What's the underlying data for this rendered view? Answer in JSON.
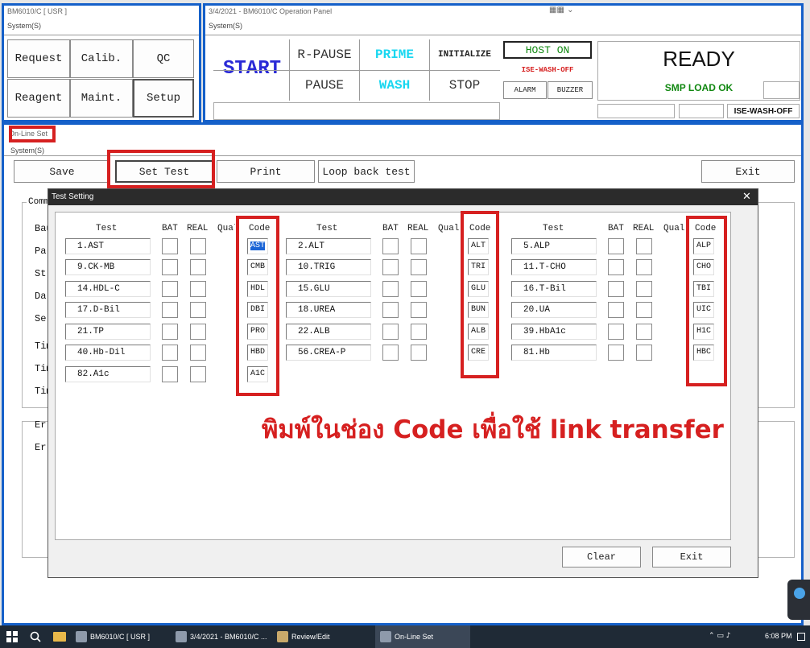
{
  "main_window": {
    "title": "BM6010/C [ USR ]",
    "menu": "System(S)",
    "buttons": [
      "Request",
      "Calib.",
      "QC",
      "Reagent",
      "Maint.",
      "Setup"
    ]
  },
  "operation_panel": {
    "title": "3/4/2021 - BM6010/C Operation Panel",
    "menu": "System(S)",
    "start": "START",
    "r_pause": "R-PAUSE",
    "pause": "PAUSE",
    "prime": "PRIME",
    "wash": "WASH",
    "initialize": "INITIALIZE",
    "stop": "STOP",
    "host_on": "HOST ON",
    "ise_wash_off": "ISE-WASH-OFF",
    "alarm": "ALARM",
    "buzzer": "BUZZER",
    "ready": "READY",
    "smp_load_ok": "SMP LOAD OK",
    "ise_wash_off_status": "ISE-WASH-OFF"
  },
  "online_set": {
    "title": "On-Line Set",
    "menu": "System(S)",
    "toolbar": {
      "save": "Save",
      "set_test": "Set Test",
      "print": "Print",
      "loop_back_test": "Loop back test",
      "exit": "Exit"
    },
    "bg_labels": [
      "Comm",
      "Bau",
      "Pa",
      "St",
      "Da",
      "Se",
      "Tim",
      "Tim",
      "Tim",
      "Er",
      "Er"
    ]
  },
  "test_setting": {
    "title": "Test Setting",
    "close_glyph": "✕",
    "headers": {
      "test": "Test",
      "bat": "BAT",
      "real": "REAL",
      "qual": "Qual",
      "code": "Code"
    },
    "columns": [
      [
        {
          "test": "1.AST",
          "code": "AST"
        },
        {
          "test": "9.CK-MB",
          "code": "CMB"
        },
        {
          "test": "14.HDL-C",
          "code": "HDL"
        },
        {
          "test": "17.D-Bil",
          "code": "DBI"
        },
        {
          "test": "21.TP",
          "code": "PRO"
        },
        {
          "test": "40.Hb-Dil",
          "code": "HBD"
        },
        {
          "test": "82.A1c",
          "code": "A1C"
        }
      ],
      [
        {
          "test": "2.ALT",
          "code": "ALT"
        },
        {
          "test": "10.TRIG",
          "code": "TRI"
        },
        {
          "test": "15.GLU",
          "code": "GLU"
        },
        {
          "test": "18.UREA",
          "code": "BUN"
        },
        {
          "test": "22.ALB",
          "code": "ALB"
        },
        {
          "test": "56.CREA-P",
          "code": "CRE"
        }
      ],
      [
        {
          "test": "5.ALP",
          "code": "ALP"
        },
        {
          "test": "11.T-CHO",
          "code": "CHO"
        },
        {
          "test": "16.T-Bil",
          "code": "TBI"
        },
        {
          "test": "20.UA",
          "code": "UIC"
        },
        {
          "test": "39.HbA1c",
          "code": "H1C"
        },
        {
          "test": "81.Hb",
          "code": "HBC"
        }
      ]
    ],
    "clear": "Clear",
    "exit": "Exit"
  },
  "annotation": "พิมพ์ในช่อง Code เพื่อใช้ link transfer",
  "taskbar": {
    "items": [
      "BM6010/C [ USR ]",
      "3/4/2021 - BM6010/C ...",
      "Review/Edit",
      "On-Line Set"
    ],
    "time": "6:08 PM"
  },
  "colors": {
    "accent_blue": "#1560c9",
    "annotation_red": "#d62020",
    "start_blue": "#2a2ad6",
    "prime_cyan": "#19d7f0",
    "host_green": "#118811"
  }
}
